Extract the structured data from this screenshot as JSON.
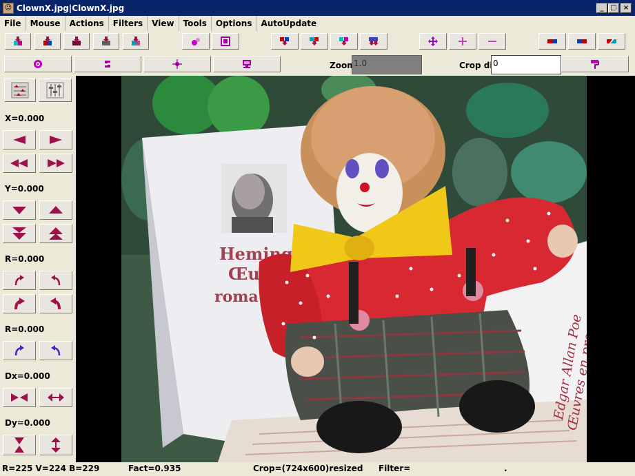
{
  "window": {
    "title": "ClownX.jpg|ClownX.jpg"
  },
  "menu": [
    "File",
    "Mouse",
    "Actions",
    "Filters",
    "View",
    "Tools",
    "Options",
    "AutoUpdate"
  ],
  "controls": {
    "zoom_label": "Zoom",
    "zoom_value": "1.0",
    "crop_label": "Crop div",
    "crop_value": "0"
  },
  "side": {
    "x_label": "X=0.000",
    "y_label": "Y=0.000",
    "r1_label": "R=0.000",
    "r2_label": "R=0.000",
    "dx_label": "Dx=0.000",
    "dy_label": "Dy=0.000"
  },
  "status": {
    "rgb": "R=225 V=224 B=229",
    "fact": "Fact=0.935",
    "crop": "Crop=(724x600)resized",
    "filter": "Filter=",
    "dot": "."
  },
  "photo": {
    "book_title_1": "Hemingw",
    "book_title_2": "Œu",
    "book_title_3": "roma",
    "spine_1": "Edgar Allan Poe",
    "spine_2": "Œuvres en prose"
  },
  "colors": {
    "accent": "#a0104a",
    "titlebar": "#0a246a"
  }
}
